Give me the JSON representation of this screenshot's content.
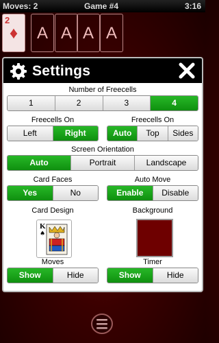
{
  "status": {
    "moves": "Moves: 2",
    "game": "Game #4",
    "time": "3:16"
  },
  "board": {
    "card_rank": "2",
    "card_suit": "♦",
    "foundations": [
      "A",
      "A",
      "A",
      "A"
    ]
  },
  "dialog": {
    "title": "Settings",
    "freecells_count": {
      "label": "Number of Freecells",
      "options": [
        "1",
        "2",
        "3",
        "4"
      ],
      "selected": "4"
    },
    "freecells_on_lr": {
      "label": "Freecells On",
      "options": [
        "Left",
        "Right"
      ],
      "selected": "Right"
    },
    "freecells_on_pos": {
      "label": "Freecells On",
      "options": [
        "Auto",
        "Top",
        "Sides"
      ],
      "selected": "Auto"
    },
    "orientation": {
      "label": "Screen Orientation",
      "options": [
        "Auto",
        "Portrait",
        "Landscape"
      ],
      "selected": "Auto"
    },
    "card_faces": {
      "label": "Card Faces",
      "options": [
        "Yes",
        "No"
      ],
      "selected": "Yes"
    },
    "auto_move": {
      "label": "Auto Move",
      "options": [
        "Enable",
        "Disable"
      ],
      "selected": "Enable"
    },
    "card_design": {
      "label": "Card Design",
      "preview_rank": "K",
      "preview_suit": "♠"
    },
    "background": {
      "label": "Background",
      "color": "#6e0000"
    },
    "moves": {
      "label": "Moves",
      "options": [
        "Show",
        "Hide"
      ],
      "selected": "Show"
    },
    "timer": {
      "label": "Timer",
      "options": [
        "Show",
        "Hide"
      ],
      "selected": "Show"
    }
  },
  "colors": {
    "accent_green": "#1aa51a",
    "felt": "#3a0000"
  }
}
